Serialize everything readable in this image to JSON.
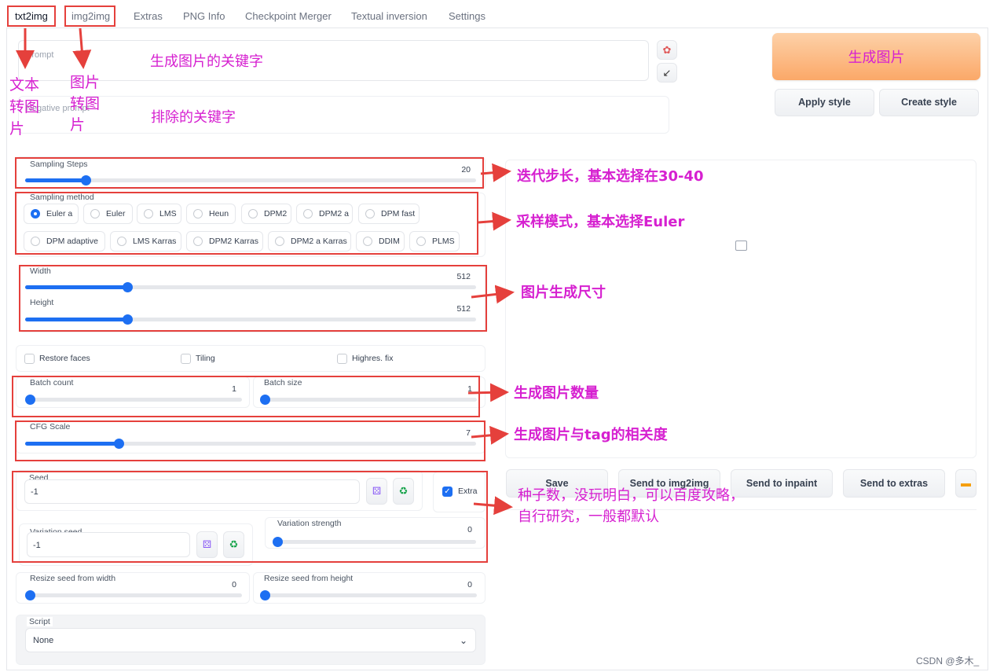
{
  "tabs": [
    "txt2img",
    "img2img",
    "Extras",
    "PNG Info",
    "Checkpoint Merger",
    "Textual inversion",
    "Settings"
  ],
  "prompt": {
    "placeholder": "Prompt"
  },
  "negative_prompt": {
    "placeholder": "Negative prompt"
  },
  "generate_button": "生成图片",
  "apply_style_button": "Apply style",
  "create_style_button": "Create style",
  "sampling_steps": {
    "label": "Sampling Steps",
    "value": "20",
    "fraction": 0.1333
  },
  "sampling_method": {
    "label": "Sampling method",
    "options": [
      "Euler a",
      "Euler",
      "LMS",
      "Heun",
      "DPM2",
      "DPM2 a",
      "DPM fast",
      "DPM adaptive",
      "LMS Karras",
      "DPM2 Karras",
      "DPM2 a Karras",
      "DDIM",
      "PLMS"
    ],
    "selected": "Euler a"
  },
  "width": {
    "label": "Width",
    "value": "512",
    "fraction": 0.2258
  },
  "height": {
    "label": "Height",
    "value": "512",
    "fraction": 0.2258
  },
  "checkboxes": {
    "restore_faces": "Restore faces",
    "tiling": "Tiling",
    "highres_fix": "Highres. fix"
  },
  "batch_count": {
    "label": "Batch count",
    "value": "1",
    "fraction": 0.0
  },
  "batch_size": {
    "label": "Batch size",
    "value": "1",
    "fraction": 0.0
  },
  "cfg_scale": {
    "label": "CFG Scale",
    "value": "7",
    "fraction": 0.2069
  },
  "seed": {
    "label": "Seed",
    "value": "-1"
  },
  "extra": {
    "label": "Extra",
    "checked": true
  },
  "variation_seed": {
    "label": "Variation seed",
    "value": "-1"
  },
  "variation_strength": {
    "label": "Variation strength",
    "value": "0",
    "fraction": 0.0
  },
  "resize_seed_width": {
    "label": "Resize seed from width",
    "value": "0",
    "fraction": 0.0
  },
  "resize_seed_height": {
    "label": "Resize seed from height",
    "value": "0",
    "fraction": 0.0
  },
  "script": {
    "label": "Script",
    "value": "None"
  },
  "output_buttons": [
    "Save",
    "Send to img2img",
    "Send to inpaint",
    "Send to extras"
  ],
  "annotations": {
    "txt2img": "文本\n转图\n片",
    "img2img": "图片\n转图\n片",
    "prompt": "生成图片的关键字",
    "negative": "排除的关键字",
    "steps": "迭代步长，基本选择在30-40",
    "method": "采样模式，基本选择Euler",
    "size": "图片生成尺寸",
    "batch": "生成图片数量",
    "cfg": "生成图片与tag的相关度",
    "seed": "种子数，没玩明白，可以百度攻略，\n自行研究，一般都默认"
  },
  "watermark": "CSDN @多木_",
  "icons": {
    "style_picker": "palette-icon",
    "paste_params": "arrow-icon",
    "dice": "dice-icon",
    "recycle": "recycle-icon",
    "folder": "folder-icon",
    "image": "image-placeholder-icon",
    "dropdown": "chevron-down-icon"
  },
  "colors": {
    "accent": "#1d6ff2",
    "annotation": "#d620d0",
    "highlight_box": "#e5403c",
    "generate_bg": "#fdb57a"
  }
}
